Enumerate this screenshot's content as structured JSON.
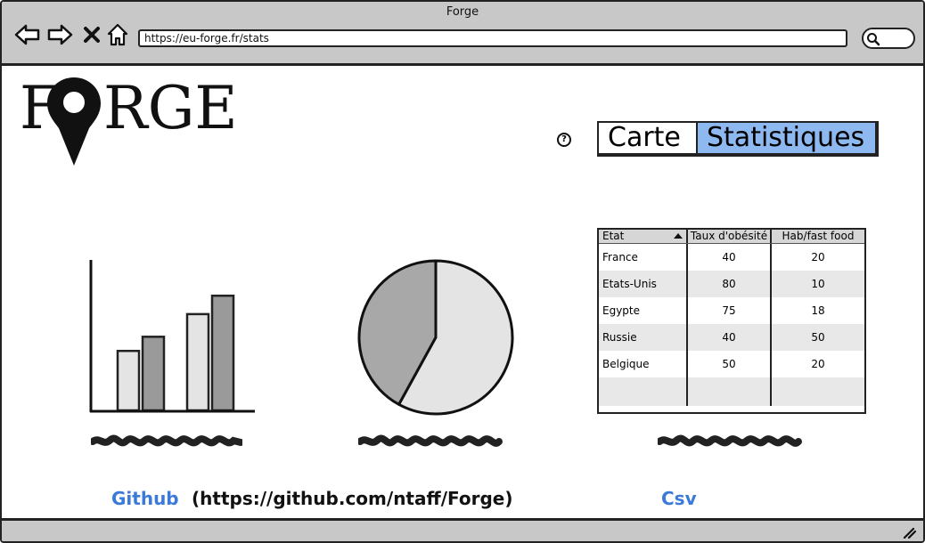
{
  "window": {
    "title": "Forge"
  },
  "browser": {
    "url": "https://eu-forge.fr/stats",
    "back_icon": "arrow-left-icon",
    "forward_icon": "arrow-right-icon",
    "stop_icon": "close-icon",
    "home_icon": "home-icon",
    "search_icon": "search-icon"
  },
  "logo": {
    "text_before": "F",
    "text_after": "RGE",
    "pin_icon": "map-pin-icon"
  },
  "help_icon": "help-icon",
  "help_glyph": "?",
  "tabs": [
    {
      "label": "Carte",
      "selected": false
    },
    {
      "label": "Statistiques",
      "selected": true
    }
  ],
  "colors": {
    "selected_tab": "#8eb8f0",
    "link": "#3b7ad8",
    "chrome": "#c8c8c8"
  },
  "chart_data": [
    {
      "type": "bar",
      "series": [
        {
          "values": [
            42,
            68
          ]
        },
        {
          "values": [
            52,
            81
          ]
        }
      ],
      "ylim": [
        0,
        100
      ]
    },
    {
      "type": "pie",
      "values": [
        58,
        42
      ]
    }
  ],
  "table": {
    "headers": [
      "Etat",
      "Taux d'obésité",
      "Hab/fast food"
    ],
    "sort_column": 0,
    "rows": [
      [
        "France",
        "40",
        "20"
      ],
      [
        "Etats-Unis",
        "80",
        "10"
      ],
      [
        "Egypte",
        "75",
        "18"
      ],
      [
        "Russie",
        "40",
        "50"
      ],
      [
        "Belgique",
        "50",
        "20"
      ]
    ]
  },
  "footer": {
    "github_label": "Github",
    "github_url_text": "(https://github.com/ntaff/Forge)",
    "csv_label": "Csv"
  }
}
